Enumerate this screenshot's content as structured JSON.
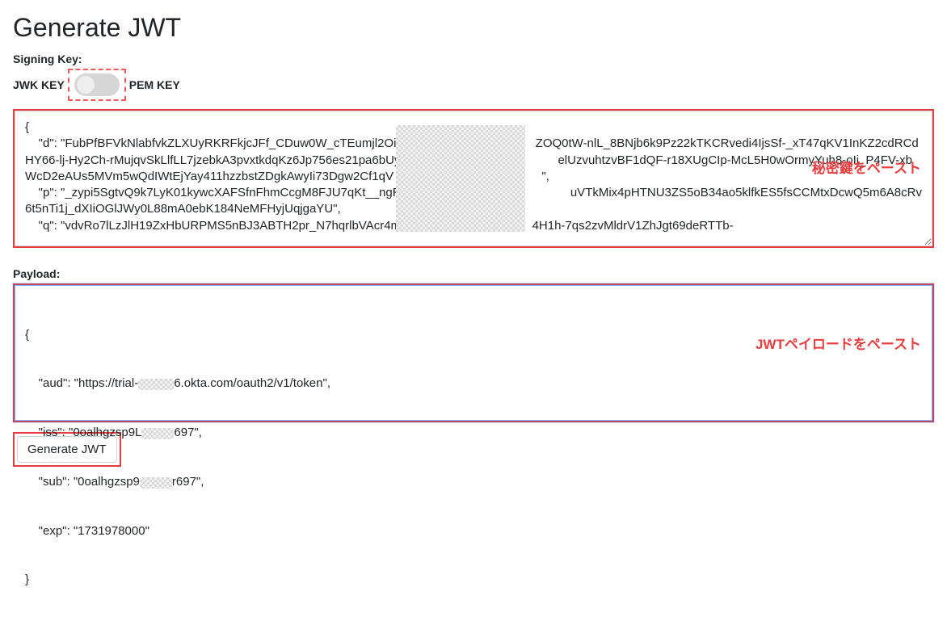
{
  "title": "Generate JWT",
  "signingKey": {
    "label": "Signing Key:",
    "leftOption": "JWK KEY",
    "rightOption": "PEM KEY",
    "overlay": "秘密鍵をペースト",
    "value": "{\n    \"d\": \"FubPfBFVkNlabfvkZLXUyRKRFkjcJFf_CDuw0W_cTEumjl2OiY                                       ZOQ0tW-nlL_8BNjb6k9Pz22kTKCRvedi4IjsSf-_xT47qKV1InKZ2cdRCdHY66-lj-Hy2Ch-rMujqvSkLlfLL7jzebkA3pvxtkdqKz6Jp756es21pa6bUylTBwl97                                  elUzvuhtzvBF1dQF-r18XUgCIp-McL5H0wOrmyYuh8-oIi_P4FV-xbWcD2eAUs5MVm5wQdIWtEjYay411hzzbstZDgkAwyIi73Dgw2Cf1qV                                            \",\n    \"p\": \"_zypi5SgtvQ9k7LyK01kywcXAFSfnFhmCcgM8FJU7qKt__ngROAebo                                       uVTkMix4pHTNU3ZS5oB34ao5klfkES5fsCCMtxDcwQ5m6A8cRv6t5nTi1j_dXIiOGlJWy0L88mA0ebK184NeMFHyjUqjgaYU\",\n    \"q\": \"vdvRo7lLzJlH19ZxHbURPMS5nBJ3ABTH2pr_N7hqrlbVAcr4m                                       4H1h-7qs2zvMldrV1ZhJgt69deRTTb-"
  },
  "payload": {
    "label": "Payload:",
    "overlay": "JWTペイロードをペースト",
    "lines": {
      "open": "{",
      "audLabel": "    \"aud\": \"https://trial-",
      "audMid": "6.okta.com/oauth2/v1/token\",",
      "issLabel": "    \"iss\": \"0oalhgzsp9L",
      "issTail": "697\",",
      "subLabel": "    \"sub\": \"0oalhgzsp9",
      "subTail": "r697\",",
      "exp": "    \"exp\": \"1731978000\"",
      "close": "}"
    }
  },
  "button": {
    "label": "Generate JWT"
  }
}
